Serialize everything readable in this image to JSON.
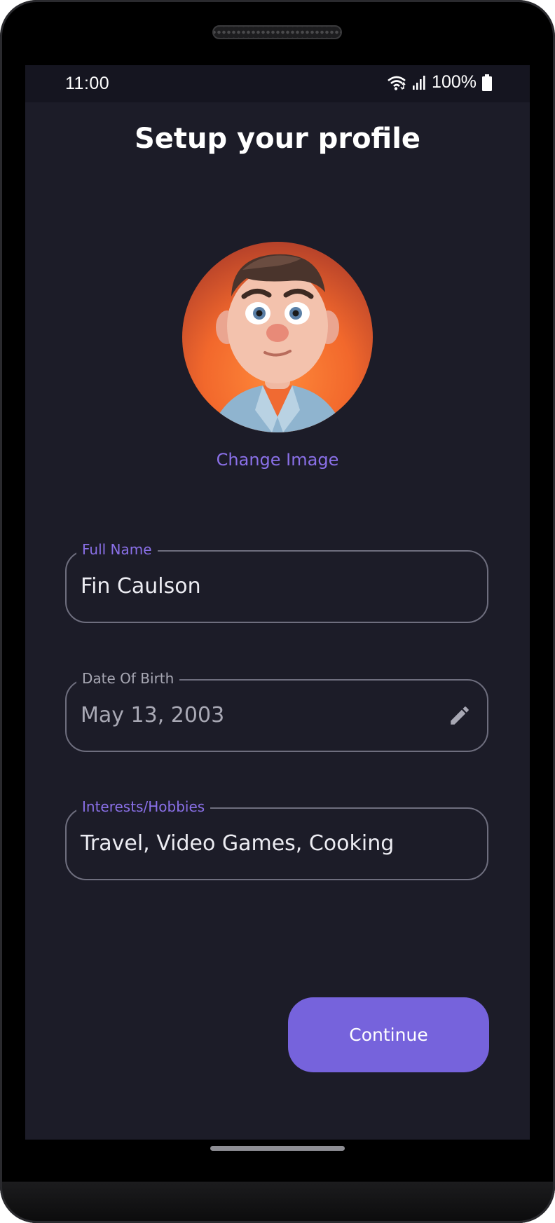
{
  "status_bar": {
    "time": "11:00",
    "battery": "100%",
    "icons": [
      "wifi-icon",
      "signal-icon",
      "battery-icon"
    ]
  },
  "page": {
    "title": "Setup your profile"
  },
  "profile_image": {
    "change_label": "Change Image"
  },
  "form": {
    "full_name": {
      "label": "Full Name",
      "value": "Fin Caulson",
      "label_color": "#8a70e8"
    },
    "date_of_birth": {
      "label": "Date Of Birth",
      "value": "May 13, 2003",
      "label_color": "#a8a8b4",
      "icon": "edit-pencil-icon"
    },
    "interests": {
      "label": "Interests/Hobbies",
      "value": "Travel, Video Games, Cooking",
      "label_color": "#8a70e8"
    }
  },
  "actions": {
    "continue_label": "Continue"
  },
  "colors": {
    "accent": "#7663dc",
    "background": "#1c1c28"
  }
}
